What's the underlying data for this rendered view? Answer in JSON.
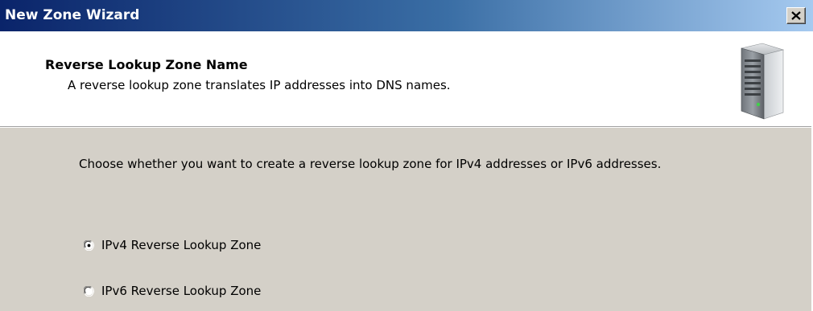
{
  "window": {
    "title": "New Zone Wizard",
    "close_glyph": "close-icon"
  },
  "header": {
    "title": "Reverse Lookup Zone Name",
    "subtitle": "A reverse lookup zone translates IP addresses into DNS names.",
    "icon": "server-icon"
  },
  "body": {
    "instructions": "Choose whether you want to create a reverse lookup zone for IPv4 addresses or IPv6 addresses.",
    "options": [
      {
        "label": "IPv4 Reverse Lookup Zone",
        "selected": true
      },
      {
        "label": "IPv6 Reverse Lookup Zone",
        "selected": false
      }
    ]
  },
  "colors": {
    "titlebar_start": "#0a246a",
    "titlebar_end": "#a6caf0",
    "dialog_background": "#d4d0c8",
    "header_background": "#ffffff"
  }
}
